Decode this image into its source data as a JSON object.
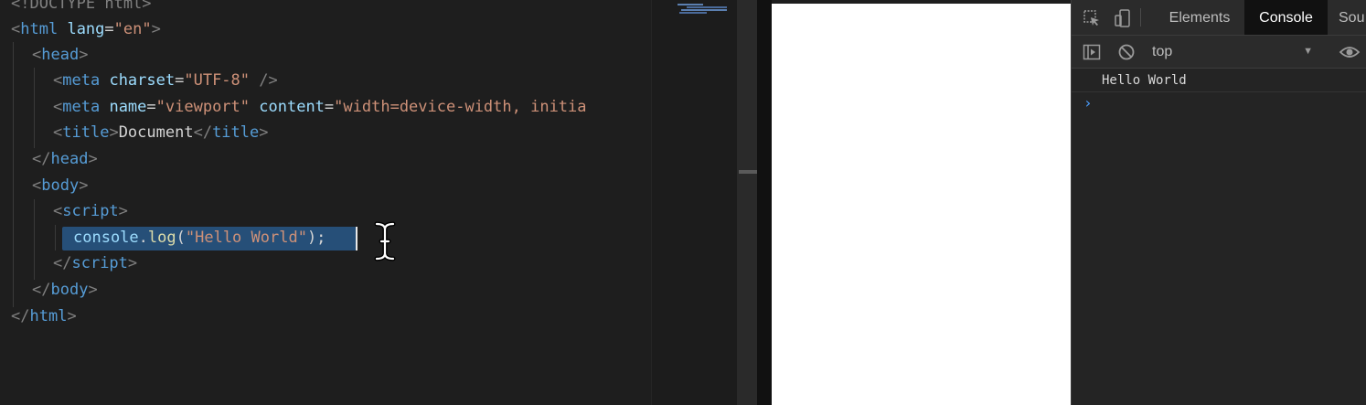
{
  "editor": {
    "line_doctype": "<!DOCTYPE html>",
    "html_tag": "html",
    "lang_attr": "lang",
    "lang_value": "\"en\"",
    "head_tag": "head",
    "meta_tag": "meta",
    "charset_attr": "charset",
    "charset_value": "\"UTF-8\"",
    "name_attr": "name",
    "name_value": "\"viewport\"",
    "content_attr": "content",
    "content_value": "\"width=device-width, initia",
    "title_tag": "title",
    "title_text": "Document",
    "body_tag": "body",
    "script_tag": "script",
    "console_obj": "console",
    "log_fn": "log",
    "log_arg": "\"Hello World\""
  },
  "devtools": {
    "tabs": [
      "Elements",
      "Console",
      "Sou"
    ],
    "active_tab": "Console",
    "context": "top",
    "log_message": "Hello World",
    "prompt": "›"
  },
  "colors": {
    "editor_bg": "#1e1e1e",
    "selection": "#264f78",
    "devtools_bg": "#242424"
  }
}
